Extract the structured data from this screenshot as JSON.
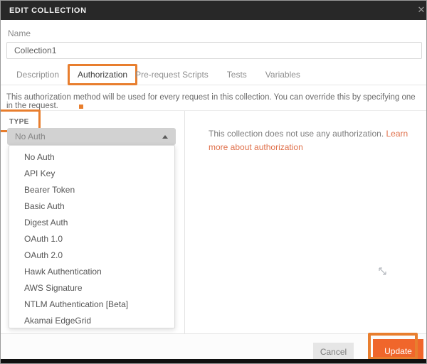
{
  "dialog": {
    "title": "EDIT COLLECTION",
    "close_icon": "✕"
  },
  "form": {
    "name_label": "Name",
    "name_value": "Collection1"
  },
  "tabs": [
    {
      "label": "Description"
    },
    {
      "label": "Authorization"
    },
    {
      "label": "Pre-request Scripts"
    },
    {
      "label": "Tests"
    },
    {
      "label": "Variables"
    }
  ],
  "active_tab": "Authorization",
  "info_bar": "This authorization method will be used for every request in this collection. You can override this by specifying one in the request.",
  "auth_panel": {
    "type_label": "TYPE",
    "selected_type": "No Auth",
    "dropdown_options": [
      "No Auth",
      "API Key",
      "Bearer Token",
      "Basic Auth",
      "Digest Auth",
      "OAuth 1.0",
      "OAuth 2.0",
      "Hawk Authentication",
      "AWS Signature",
      "NTLM Authentication [Beta]",
      "Akamai EdgeGrid"
    ]
  },
  "right_panel": {
    "message": "This collection does not use any authorization. ",
    "link_text": "Learn more about authorization"
  },
  "footer": {
    "cancel_label": "Cancel",
    "update_label": "Update"
  },
  "colors": {
    "annotation_orange": "#e87e2e",
    "button_orange": "#f0662b",
    "link_orange": "#e0714c",
    "header_bg": "#282828"
  }
}
